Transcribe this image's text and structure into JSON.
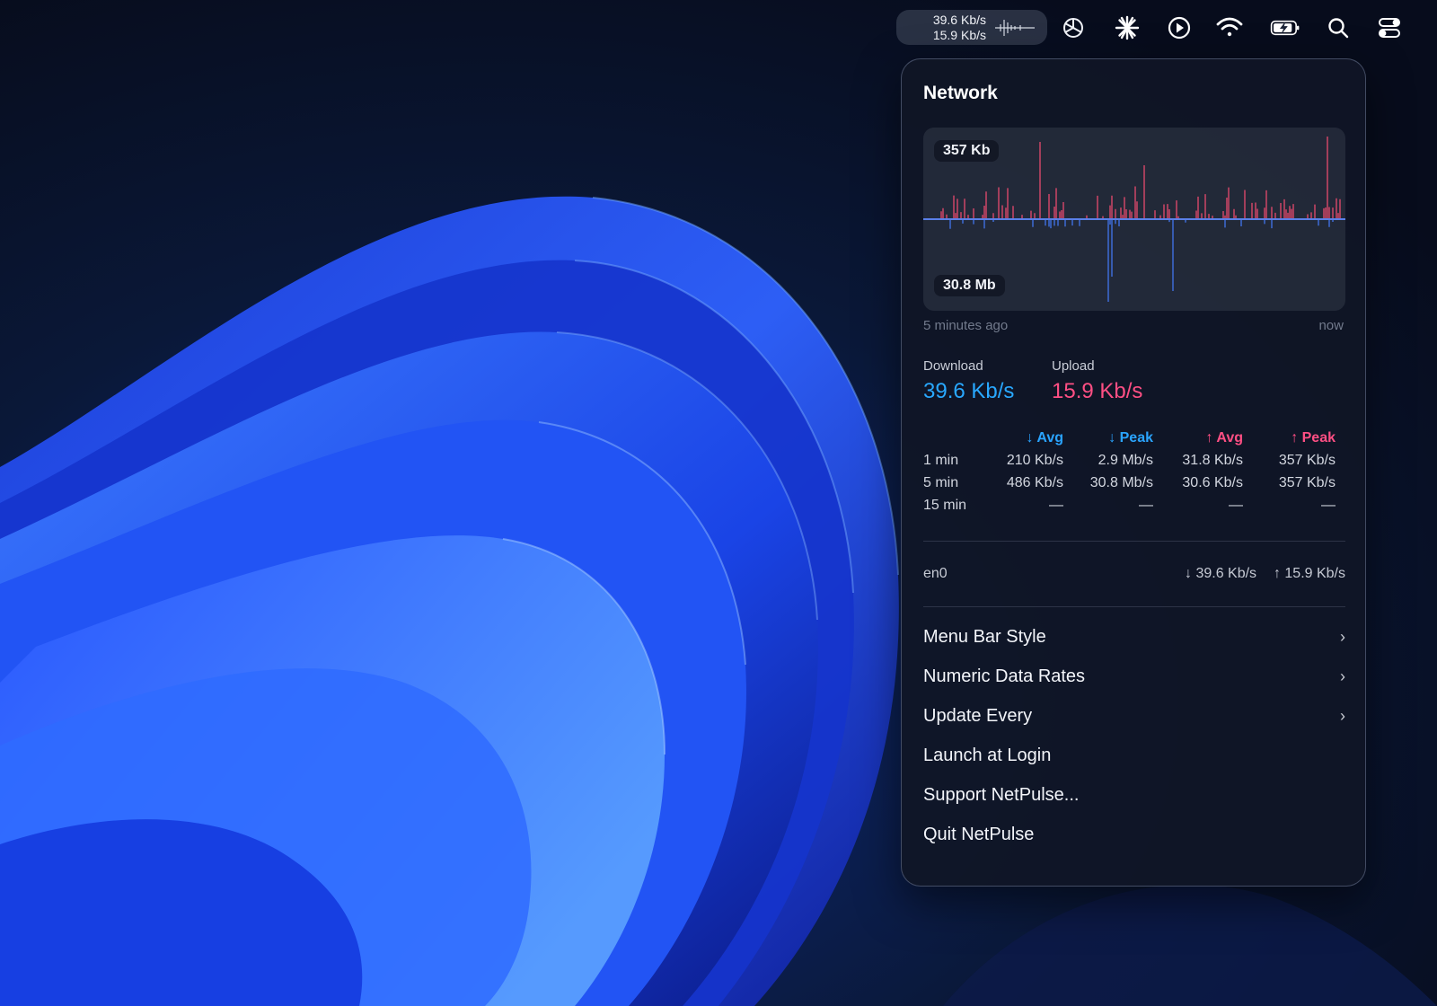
{
  "menubar": {
    "net_down": "39.6 Kb/s",
    "net_up": "15.9 Kb/s",
    "icons": [
      "netpulse-sparkline-icon",
      "chatgpt-icon",
      "claude-icon",
      "play-icon",
      "wifi-icon",
      "battery-charging-icon",
      "search-icon",
      "control-center-icon"
    ]
  },
  "popover": {
    "title": "Network",
    "chart": {
      "top_label": "357 Kb",
      "bottom_label": "30.8 Mb",
      "time_start": "5 minutes ago",
      "time_end": "now"
    },
    "download": {
      "label": "Download",
      "value": "39.6 Kb/s"
    },
    "upload": {
      "label": "Upload",
      "value": "15.9 Kb/s"
    },
    "stats": {
      "headers": [
        "↓ Avg",
        "↓ Peak",
        "↑ Avg",
        "↑ Peak"
      ],
      "rows": [
        {
          "label": "1 min",
          "values": [
            "210 Kb/s",
            "2.9 Mb/s",
            "31.8 Kb/s",
            "357 Kb/s"
          ]
        },
        {
          "label": "5 min",
          "values": [
            "486 Kb/s",
            "30.8 Mb/s",
            "30.6 Kb/s",
            "357 Kb/s"
          ]
        },
        {
          "label": "15 min",
          "values": [
            "—",
            "—",
            "—",
            "—"
          ]
        }
      ]
    },
    "interface": {
      "name": "en0",
      "down": "↓ 39.6 Kb/s",
      "up": "↑ 15.9 Kb/s"
    },
    "menu": [
      {
        "label": "Menu Bar Style",
        "submenu": true
      },
      {
        "label": "Numeric Data Rates",
        "submenu": true
      },
      {
        "label": "Update Every",
        "submenu": true
      },
      {
        "label": "Launch at Login",
        "submenu": false
      },
      {
        "label": "Support NetPulse...",
        "submenu": false
      },
      {
        "label": "Quit NetPulse",
        "submenu": false
      }
    ],
    "colors": {
      "download": "#29a8ff",
      "upload": "#ff4f84",
      "upload_bar": "#d9486a",
      "download_bar": "#3f6fe0"
    }
  }
}
